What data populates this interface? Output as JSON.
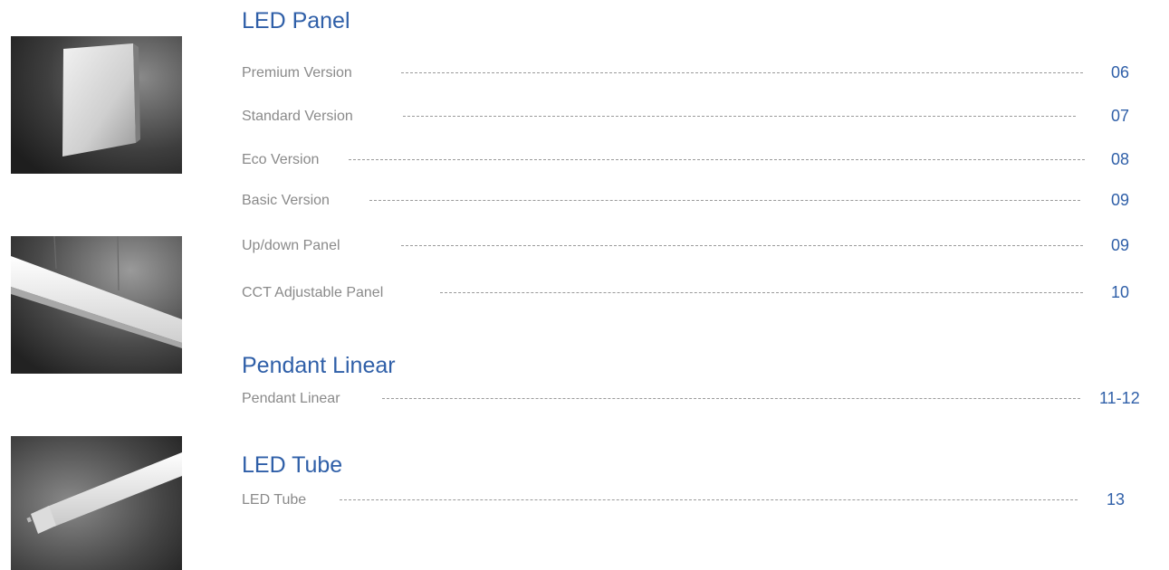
{
  "sections": [
    {
      "title": "LED Panel",
      "items": [
        {
          "label": "Premium Version",
          "page": "06"
        },
        {
          "label": "Standard Version",
          "page": "07"
        },
        {
          "label": "Eco Version",
          "page": "08"
        },
        {
          "label": "Basic Version",
          "page": "09"
        },
        {
          "label": "Up/down Panel",
          "page": "09"
        },
        {
          "label": "CCT Adjustable Panel",
          "page": "10"
        }
      ]
    },
    {
      "title": "Pendant Linear",
      "items": [
        {
          "label": "Pendant Linear",
          "page": "11-12"
        }
      ]
    },
    {
      "title": "LED Tube",
      "items": [
        {
          "label": "LED Tube",
          "page": "13"
        }
      ]
    }
  ],
  "images": [
    {
      "icon": "led-panel-photo"
    },
    {
      "icon": "pendant-linear-photo"
    },
    {
      "icon": "led-tube-photo"
    }
  ],
  "colors": {
    "heading": "#2f5fa8",
    "page_number": "#2f5fa8",
    "label": "#8a8a8a",
    "leader": "#9a9a9a"
  }
}
